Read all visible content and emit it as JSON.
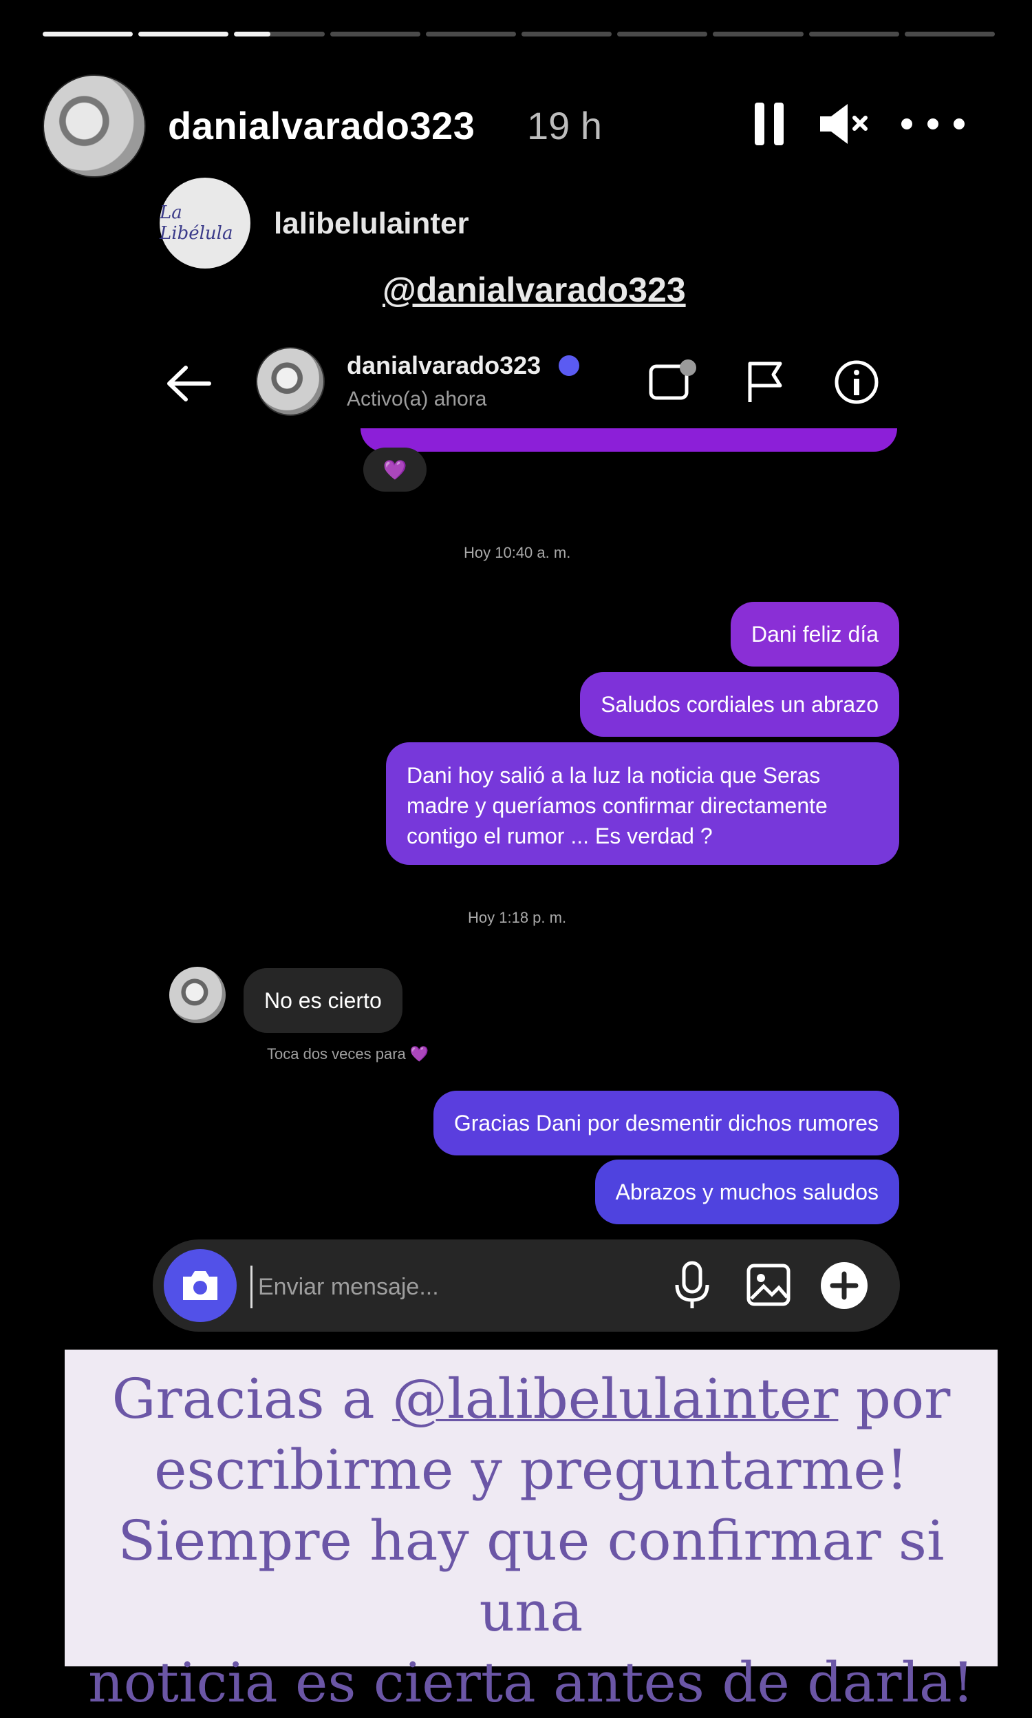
{
  "story": {
    "username": "danialvarado323",
    "time_ago": "19 h",
    "segments_total": 10,
    "segment_progress": [
      1,
      1,
      0.4,
      0,
      0,
      0,
      0,
      0,
      0,
      0
    ]
  },
  "sticker": {
    "username": "lalibelulainter",
    "logo_text": "La Libélula",
    "mention": "@danialvarado323"
  },
  "dm": {
    "username": "danialvarado323",
    "status": "Activo(a) ahora",
    "reaction": "💜",
    "timestamp1": "Hoy 10:40 a. m.",
    "timestamp2": "Hoy 1:18 p. m.",
    "msg1": "Dani feliz día",
    "msg2": "Saludos cordiales un abrazo",
    "msg3": "Dani hoy salió a la luz la noticia que Seras madre y queríamos confirmar directamente contigo el rumor ... Es verdad ?",
    "incoming": "No es cierto",
    "hint": "Toca dos veces para",
    "msg4": "Gracias Dani por desmentir dichos rumores",
    "msg5": "Abrazos y muchos saludos",
    "composer_placeholder": "Enviar mensaje..."
  },
  "caption": {
    "line1_pre": "Gracias a ",
    "line1_mention": "@lalibelulainter",
    "line1_post": " por",
    "line2": "escribirme y preguntarme!",
    "line3": "Siempre hay que confirmar si una",
    "line4": "noticia es cierta antes de darla!"
  },
  "colors": {
    "accent": "#5251e8",
    "bubble_purple": "#7738da",
    "caption_text": "#6b56a6",
    "caption_bg": "#efeaf3"
  },
  "icons": [
    "pause-icon",
    "mute-icon",
    "more-icon",
    "back-arrow-icon",
    "video-call-icon",
    "flag-icon",
    "info-icon",
    "camera-icon",
    "microphone-icon",
    "gallery-icon",
    "plus-icon",
    "heart-icon"
  ]
}
